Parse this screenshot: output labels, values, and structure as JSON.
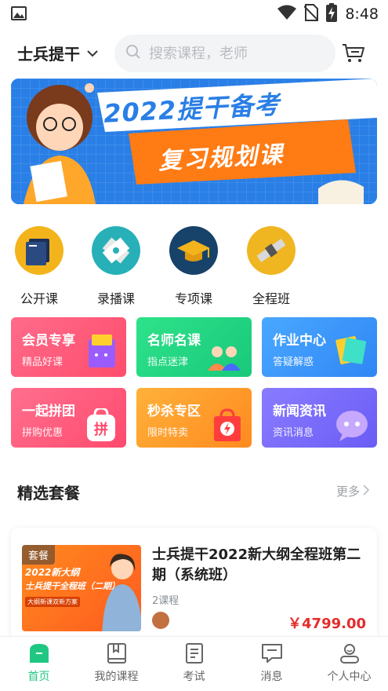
{
  "status_bar": {
    "time": "8:48"
  },
  "header": {
    "location": "士兵提干",
    "search_placeholder": "搜索课程，老师"
  },
  "banner": {
    "line1": "2022提干备考",
    "line2": "复习规划课"
  },
  "categories": [
    {
      "label": "公开课",
      "color": "#f3b41b",
      "icon": "book-icon"
    },
    {
      "label": "录播课",
      "color": "#27b0b8",
      "icon": "film-icon"
    },
    {
      "label": "专项课",
      "color": "#17426a",
      "icon": "graduation-cap-icon"
    },
    {
      "label": "全程班",
      "color": "#f0b622",
      "icon": "satellite-icon"
    }
  ],
  "tiles": [
    {
      "title": "会员专享",
      "sub": "精品好课",
      "from": "#ff6b8a",
      "to": "#ff4d6d"
    },
    {
      "title": "名师名课",
      "sub": "指点迷津",
      "from": "#2ee28a",
      "to": "#19c97a"
    },
    {
      "title": "作业中心",
      "sub": "答疑解惑",
      "from": "#4aa8ff",
      "to": "#2f86f5"
    },
    {
      "title": "一起拼团",
      "sub": "拼购优惠",
      "from": "#ff6f8e",
      "to": "#ff4a6e"
    },
    {
      "title": "秒杀专区",
      "sub": "限时特卖",
      "from": "#ffb13a",
      "to": "#ff8a1f"
    },
    {
      "title": "新闻资讯",
      "sub": "资讯消息",
      "from": "#8a7cff",
      "to": "#6a5cf5"
    }
  ],
  "section": {
    "title": "精选套餐",
    "more": "更多"
  },
  "package": {
    "tag": "套餐",
    "thumb_line1": "2022新大纲",
    "thumb_line2": "士兵提干全程班（二期）",
    "thumb_line3": "大纲新课双新方案",
    "title": "士兵提干2022新大纲全程班第二期（系统班）",
    "count": "2课程",
    "price": "￥4799.00"
  },
  "bottom_nav": [
    {
      "label": "首页",
      "icon": "home-icon",
      "active": true
    },
    {
      "label": "我的课程",
      "icon": "bookmark-book-icon",
      "active": false
    },
    {
      "label": "考试",
      "icon": "exam-paper-icon",
      "active": false
    },
    {
      "label": "消息",
      "icon": "message-icon",
      "active": false
    },
    {
      "label": "个人中心",
      "icon": "profile-icon",
      "active": false
    }
  ],
  "colors": {
    "accent": "#20c782",
    "price": "#e62b2b"
  }
}
